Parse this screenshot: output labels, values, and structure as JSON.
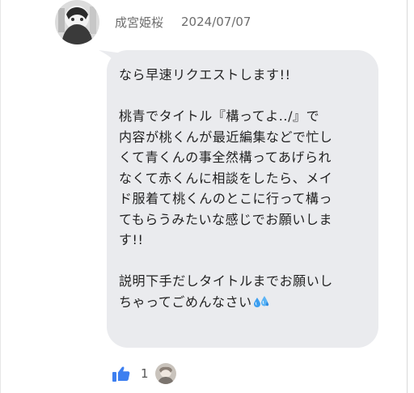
{
  "comment": {
    "author": "成宮姫桜",
    "date": "2024/07/07",
    "message_lines": [
      "なら早速リクエストします!!",
      "",
      "桃青でタイトル『構ってよ../』で",
      "内容が桃くんが最近編集などで忙し",
      "くて青くんの事全然構ってあげられ",
      "なくて赤くんに相談をしたら、メイ",
      "ド服着て桃くんのとこに行って構っ",
      "てもらうみたいな感じでお願いしま",
      "す!!",
      "",
      "説明下手だしタイトルまでお願いし",
      "ちゃってごめんなさい"
    ],
    "trailing_icon": "sweat-droplets-icon",
    "likes": {
      "icon": "thumbs-up-icon",
      "count": "1"
    }
  },
  "colors": {
    "bubble": "#eaebee",
    "like_blue": "#3d7ff0",
    "meta_text": "#6d6d6d",
    "message_text": "#222222"
  }
}
